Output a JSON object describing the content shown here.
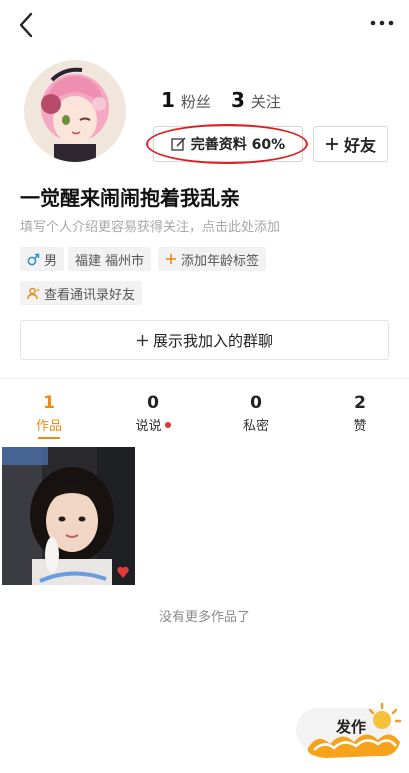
{
  "topbar": {
    "back_icon": "back-icon",
    "more_icon": "more-icon"
  },
  "profile": {
    "fans_count": "1",
    "fans_label": "粉丝",
    "following_count": "3",
    "following_label": "关注",
    "complete_profile_label": "完善资料 60%",
    "complete_profile_progress": 60,
    "add_friend_label": "好友",
    "nickname": "一觉醒来闹闹抱着我乱亲",
    "bio_placeholder": "填写个人介绍更容易获得关注，点击此处添加",
    "tags": {
      "gender": "男",
      "location": "福建 福州市",
      "add_age_tag": "添加年龄标签",
      "view_contacts": "查看通讯录好友"
    },
    "groups_label": "展示我加入的群聊"
  },
  "tabs": [
    {
      "count": "1",
      "label": "作品",
      "active": true
    },
    {
      "count": "0",
      "label": "说说",
      "has_dot": true
    },
    {
      "count": "0",
      "label": "私密"
    },
    {
      "count": "2",
      "label": "赞"
    }
  ],
  "works": {
    "end_text": "没有更多作品了"
  },
  "publish": {
    "label": "发作"
  },
  "colors": {
    "accent": "#ee8a16",
    "annotation": "#e02020",
    "badge": "#e33030"
  }
}
